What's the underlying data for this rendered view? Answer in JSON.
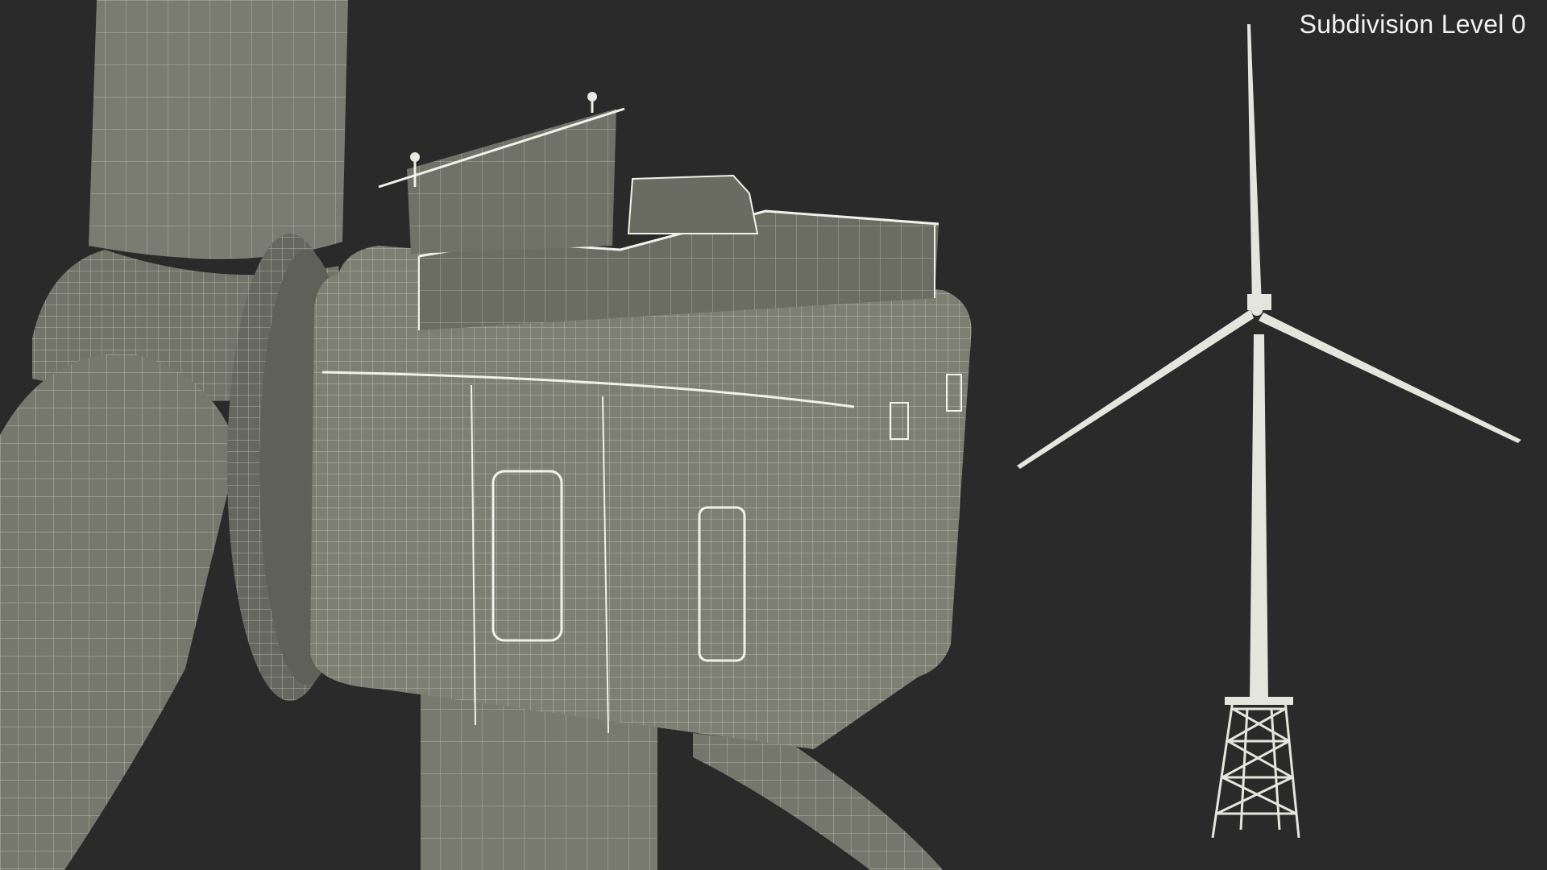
{
  "viewport": {
    "overlay_label": "Subdivision Level 0"
  },
  "colors": {
    "background": "#2a2a2a",
    "model_fill": "#7d7f73",
    "model_fill_dark": "#65675d",
    "wire": "#e9eadf",
    "mini_model": "#e4e5dc"
  }
}
